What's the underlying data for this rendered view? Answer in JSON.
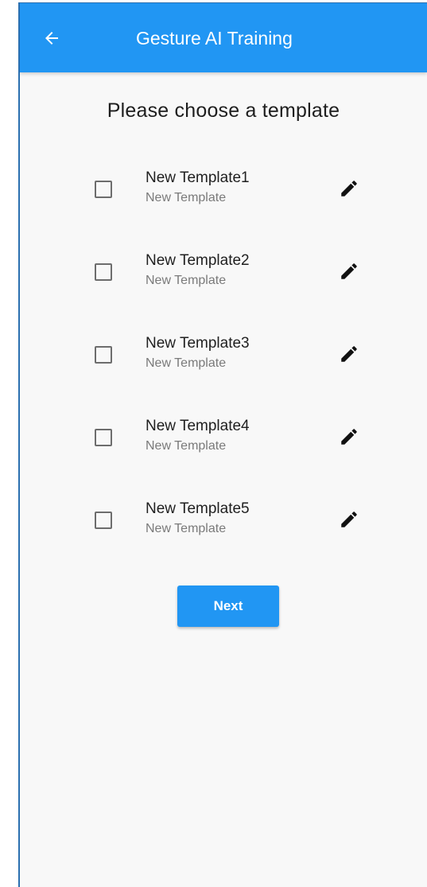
{
  "colors": {
    "appbar": "#2196f3",
    "background": "#f8f8f8",
    "button": "#2196f3",
    "text_primary": "#1f1f1f",
    "text_secondary": "#7a7a7a"
  },
  "appbar": {
    "back_icon": "arrow-back-icon",
    "title": "Gesture AI Training"
  },
  "heading": "Please choose a template",
  "templates": [
    {
      "title": "New Template1",
      "subtitle": "New Template",
      "checked": false,
      "edit_icon": "pencil-icon"
    },
    {
      "title": "New Template2",
      "subtitle": "New Template",
      "checked": false,
      "edit_icon": "pencil-icon"
    },
    {
      "title": "New Template3",
      "subtitle": "New Template",
      "checked": false,
      "edit_icon": "pencil-icon"
    },
    {
      "title": "New Template4",
      "subtitle": "New Template",
      "checked": false,
      "edit_icon": "pencil-icon"
    },
    {
      "title": "New Template5",
      "subtitle": "New Template",
      "checked": false,
      "edit_icon": "pencil-icon"
    }
  ],
  "next_label": "Next"
}
